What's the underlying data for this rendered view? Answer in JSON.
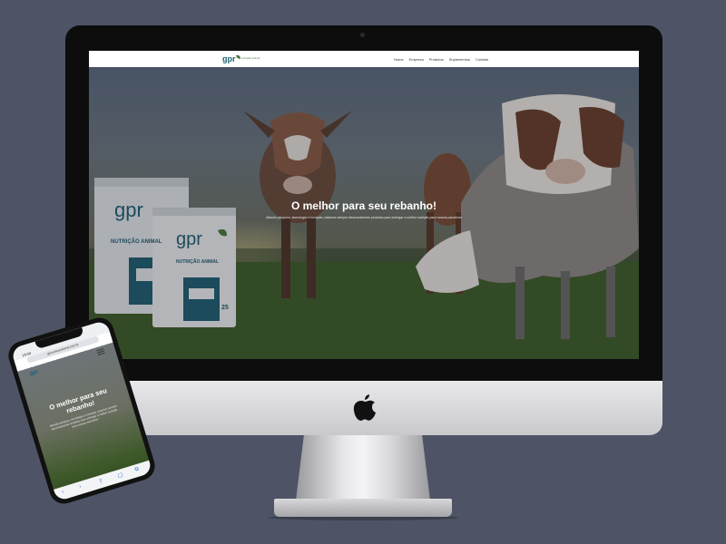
{
  "site": {
    "logo_text": "gpr",
    "logo_sub": "nutrição animal",
    "nav": [
      "Home",
      "Empresa",
      "Produtos",
      "Suplementos",
      "Contato"
    ],
    "hero_title": "O melhor para seu rebanho!",
    "hero_subtitle": "Aliando pesquisa, tecnologia e inovação, estamos sempre desenvolvendo produtos para entregar a melhor nutrição para nossos parceiros!",
    "product_bag_brand": "gpr",
    "product_bag_label": "NUTRIÇÃO ANIMAL",
    "product_bag_weight": "25"
  },
  "mobile": {
    "time": "14:04",
    "url": "gprnutricaoanimal.com.br",
    "hero_title": "O melhor para seu rebanho!",
    "hero_subtitle": "Aliando pesquisa, tecnologia e inovação, estamos sempre desenvolvendo produtos para entregar a melhor nutrição para nossos parceiros!",
    "toolbar": [
      "‹",
      "›",
      "⇧",
      "▢",
      "⧉"
    ]
  },
  "colors": {
    "background": "#4e5466",
    "brand_green": "#4a7a3a",
    "brand_teal": "#1f5f73"
  },
  "icons": [
    "apple-logo-icon",
    "hamburger-menu-icon",
    "back-icon",
    "forward-icon",
    "share-icon",
    "bookmarks-icon",
    "tabs-icon"
  ]
}
